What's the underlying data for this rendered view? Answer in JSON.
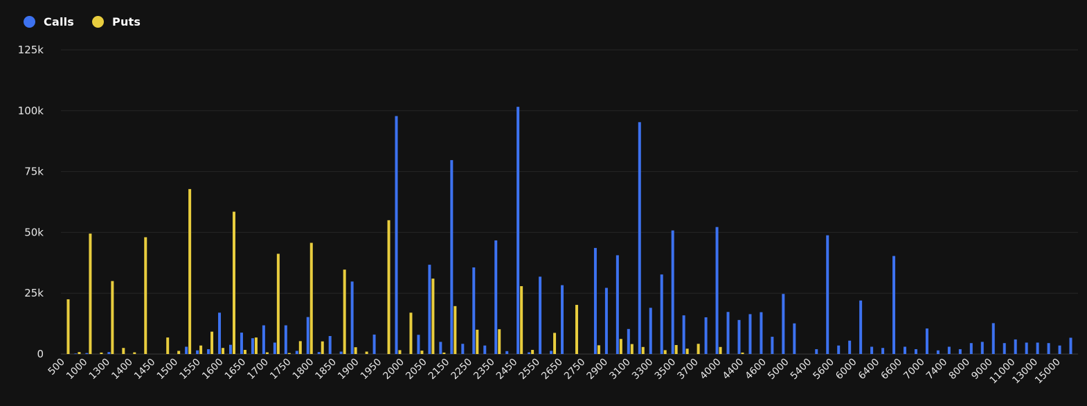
{
  "legend": {
    "calls_label": "Calls",
    "puts_label": "Puts"
  },
  "colors": {
    "background": "#121212",
    "calls": "#3d72f0",
    "puts": "#e8cd3e",
    "grid": "#262626",
    "text": "#e8e8e8"
  },
  "chart_data": {
    "type": "bar",
    "title": "",
    "xlabel": "",
    "ylabel": "",
    "ylim": [
      0,
      125000
    ],
    "y_ticks": [
      "0",
      "25k",
      "50k",
      "75k",
      "100k",
      "125k"
    ],
    "grid": "horizontal",
    "legend_position": "top-left",
    "x_tick_labels": [
      "500",
      "1000",
      "1300",
      "1400",
      "1450",
      "1500",
      "1550",
      "1600",
      "1650",
      "1700",
      "1750",
      "1800",
      "1850",
      "1900",
      "1950",
      "2000",
      "2050",
      "2150",
      "2250",
      "2350",
      "2450",
      "2550",
      "2650",
      "2750",
      "2900",
      "3100",
      "3300",
      "3500",
      "3700",
      "4000",
      "4400",
      "4600",
      "5000",
      "5400",
      "5600",
      "6000",
      "6400",
      "6600",
      "7000",
      "7400",
      "8000",
      "9000",
      "11000",
      "13000",
      "15000"
    ],
    "series": [
      {
        "name": "Calls",
        "values": [
          0,
          200,
          400,
          0,
          800,
          0,
          0,
          0,
          0,
          0,
          0,
          3000,
          1500,
          2000,
          17000,
          3800,
          8800,
          6500,
          11800,
          4700,
          11800,
          1300,
          15200,
          800,
          7400,
          1000,
          29800,
          0,
          8000,
          0,
          97800,
          0,
          7900,
          36700,
          5000,
          79700,
          4200,
          35600,
          3500,
          46700,
          1200,
          101600,
          700,
          31800,
          1300,
          28300,
          0,
          0,
          43600,
          27200,
          40600,
          10300,
          95300,
          19000,
          32700,
          50800,
          15900,
          0,
          15100,
          52200,
          17300,
          14000,
          16400,
          17200,
          7100,
          24700,
          12600,
          0,
          2000,
          48800,
          3500,
          5500,
          22000,
          3000,
          2500,
          40300,
          3000,
          2000,
          10500,
          1500,
          3000,
          2000,
          4500,
          5000,
          12700,
          4500,
          6000,
          4700,
          4700,
          4500,
          3500,
          6700
        ]
      },
      {
        "name": "Puts",
        "values": [
          22500,
          800,
          49500,
          600,
          30000,
          2500,
          700,
          48000,
          0,
          6800,
          1300,
          67800,
          3500,
          9200,
          2500,
          58500,
          1700,
          6800,
          700,
          41200,
          400,
          5300,
          45700,
          5200,
          0,
          34700,
          2800,
          1000,
          0,
          55000,
          1600,
          17000,
          1400,
          31000,
          600,
          19700,
          0,
          10000,
          0,
          10200,
          0,
          27900,
          1700,
          0,
          8700,
          0,
          20200,
          0,
          3600,
          0,
          6200,
          4100,
          2900,
          0,
          1600,
          3700,
          2200,
          4200,
          0,
          2900,
          0,
          600
        ]
      }
    ]
  }
}
